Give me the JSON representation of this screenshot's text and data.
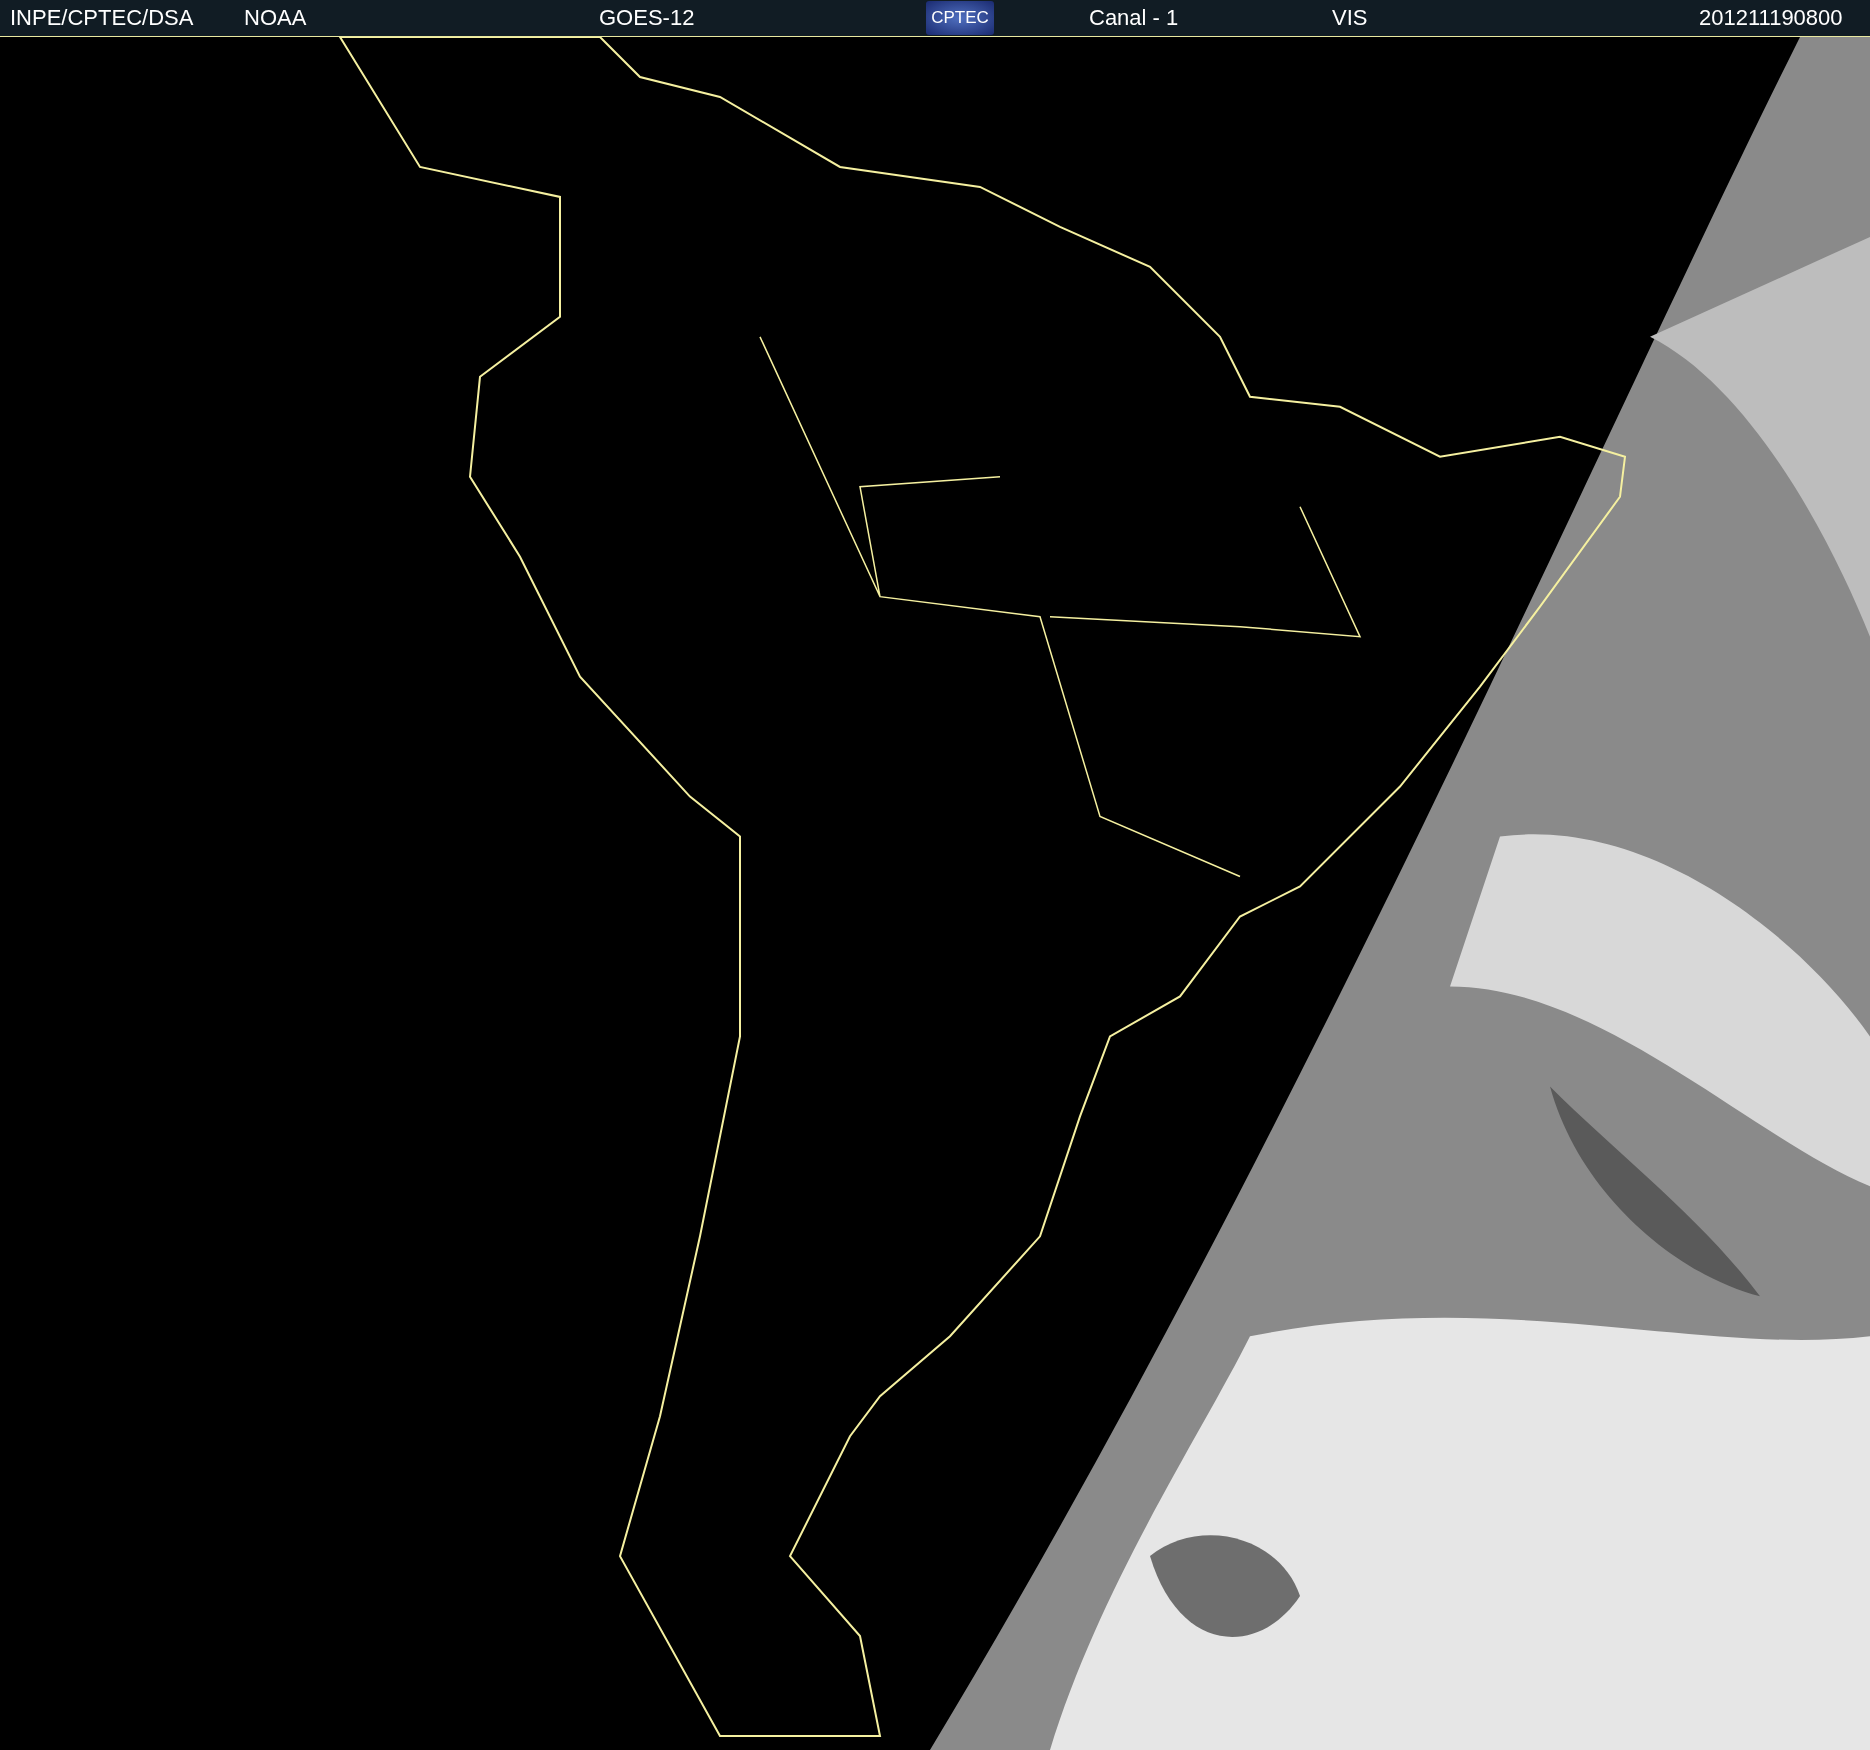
{
  "header": {
    "source": "INPE/CPTEC/DSA",
    "agency": "NOAA",
    "satellite": "GOES-12",
    "logo": "CPTEC",
    "channel": "Canal - 1",
    "band": "VIS",
    "timestamp": "201211190800"
  }
}
